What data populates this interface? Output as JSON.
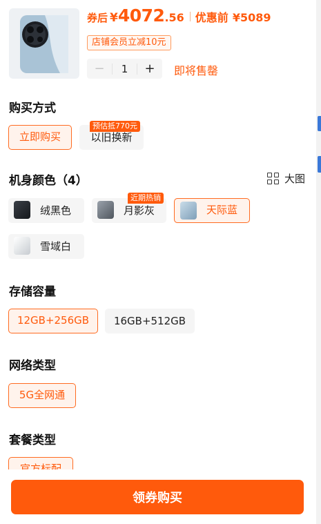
{
  "product": {
    "price_label": "券后",
    "currency": "¥",
    "price_int": "4072",
    "price_dec": ".56",
    "orig_label": "优惠前",
    "orig_price": "¥5089",
    "coupon": "店铺会员立减10元",
    "quantity": "1",
    "minus": "−",
    "plus": "+",
    "status": "即将售罄"
  },
  "purchase": {
    "title": "购买方式",
    "options": [
      {
        "label": "立即购买",
        "selected": true
      },
      {
        "label": "以旧换新",
        "selected": false,
        "tag": "预估抵770元"
      }
    ]
  },
  "color": {
    "title": "机身颜色（4）",
    "big_view": "大图",
    "options": [
      {
        "label": "绒黑色",
        "selected": false,
        "swatch": "#1f2328"
      },
      {
        "label": "月影灰",
        "selected": false,
        "swatch": "#6e7680",
        "tag": "近期热销"
      },
      {
        "label": "天际蓝",
        "selected": true,
        "swatch": "#8fb2cc"
      },
      {
        "label": "雪域白",
        "selected": false,
        "swatch": "#e9ecef"
      }
    ]
  },
  "storage": {
    "title": "存储容量",
    "options": [
      {
        "label": "12GB+256GB",
        "selected": true
      },
      {
        "label": "16GB+512GB",
        "selected": false
      }
    ]
  },
  "network": {
    "title": "网络类型",
    "options": [
      {
        "label": "5G全网通",
        "selected": true
      }
    ]
  },
  "bundle": {
    "title": "套餐类型",
    "options": [
      {
        "label": "官方标配",
        "selected": true
      }
    ]
  },
  "cta": {
    "label": "领券购买"
  },
  "colors": {
    "accent": "#ff5a0c",
    "chip_bg": "#f5f5f5",
    "selected_bg": "#fff3ec",
    "edge_mark": "#3a78d8"
  }
}
